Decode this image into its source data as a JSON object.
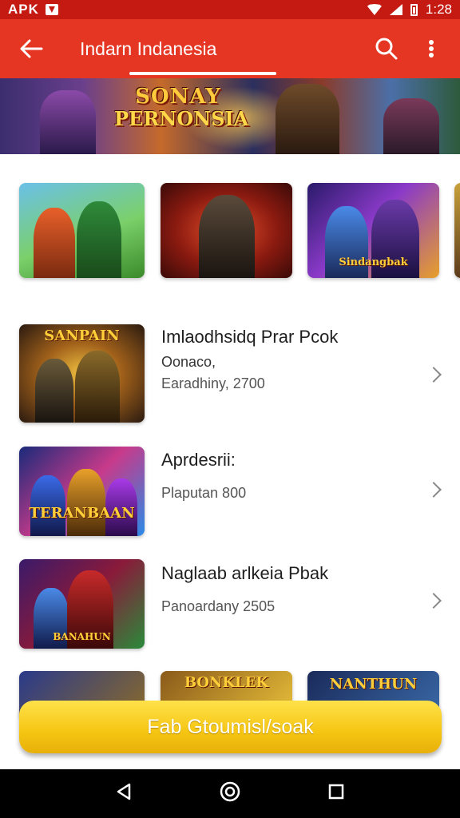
{
  "status_bar": {
    "carrier": "APK",
    "time": "1:28"
  },
  "app_bar": {
    "title": "Indarn Indanesia",
    "back_icon": "back-arrow-icon",
    "search_icon": "search-icon",
    "menu_icon": "more-vert-icon"
  },
  "banner": {
    "logo_line1": "SONAY",
    "logo_line2": "PERNONSIA"
  },
  "top_thumbs": [
    {
      "caption": ""
    },
    {
      "caption": ""
    },
    {
      "caption": "Sindangbak"
    }
  ],
  "list": [
    {
      "thumb_caption": "SANPAIN",
      "title": "Imlaodhsidq Prar Pcok",
      "subtitle": "Oonaco,",
      "meta": "Earadhiny, 2700"
    },
    {
      "thumb_caption": "TERANBAAN",
      "title": "Aprdesrii:",
      "subtitle": "",
      "meta": "Plaputan 800"
    },
    {
      "thumb_caption": "BANAHUN",
      "title": "Naglaab arlkeia Pbak",
      "subtitle": "",
      "meta": "Panoardany 2505"
    }
  ],
  "bottom_thumbs": [
    {
      "caption": ""
    },
    {
      "caption": "BONKLEK"
    },
    {
      "caption": "NANTHUN"
    }
  ],
  "fab": {
    "label": "Fab Gtoumisl/soak"
  },
  "nav": {
    "back": "nav-back-icon",
    "home": "nav-home-icon",
    "recents": "nav-recents-icon"
  },
  "colors": {
    "appbar": "#e53624",
    "statusbar": "#c41a12",
    "fab": "#f5c512"
  }
}
